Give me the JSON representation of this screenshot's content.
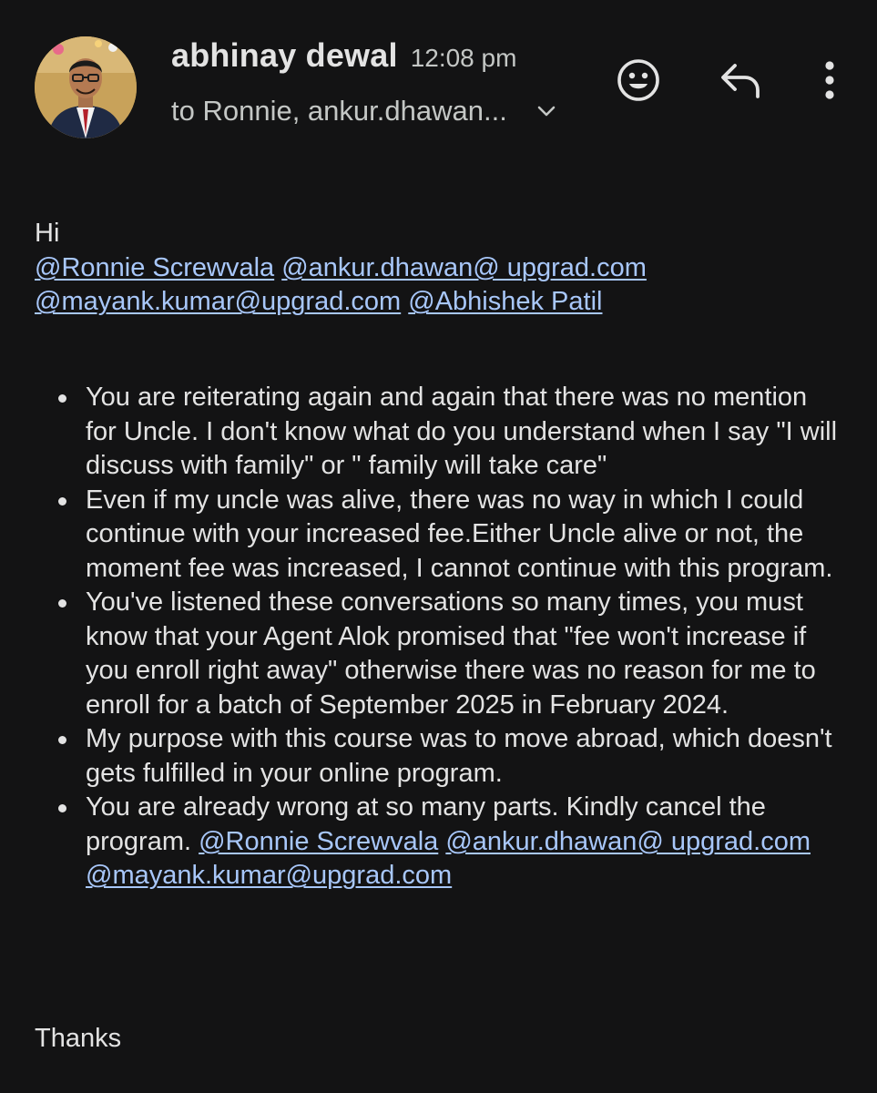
{
  "theme": {
    "background": "#131314",
    "text": "#e3e3e3",
    "secondary_text": "#c4c7c5",
    "link": "#a8c7fa"
  },
  "header": {
    "sender_name": "abhinay dewal",
    "time": "12:08 pm",
    "recipients": "to Ronnie, ankur.dhawan...",
    "icons": [
      "emoji-reaction-icon",
      "reply-icon",
      "more-vert-icon",
      "chevron-down-icon"
    ]
  },
  "body": {
    "greeting": "Hi",
    "mentions": [
      "@Ronnie Screwvala",
      "@ankur.dhawan@ upgrad.com",
      "@mayank.kumar@upgrad.com",
      "@Abhishek Patil"
    ],
    "bullets": [
      {
        "text": "You are reiterating again and again that there was no mention for Uncle. I don't know what do you understand when I say \"I will discuss with family\" or \" family will take care\""
      },
      {
        "text": "Even if my uncle was alive, there was no way in which I could continue with your increased fee.Either Uncle alive or not, the moment fee was increased, I cannot continue with this program."
      },
      {
        "text": "You've listened these conversations so many times, you must know that your Agent Alok promised that \"fee won't increase if you enroll right away\" otherwise there was no reason for me to enroll for a batch of September 2025 in February 2024."
      },
      {
        "text": "My purpose with this course was to move abroad, which doesn't gets fulfilled in your online program."
      },
      {
        "text": "You are already wrong at so many parts. Kindly cancel the program.",
        "mentions": [
          "@Ronnie Screwvala",
          "@ankur.dhawan@ upgrad.com",
          "@mayank.kumar@upgrad.com"
        ]
      }
    ],
    "signoff": "Thanks"
  }
}
